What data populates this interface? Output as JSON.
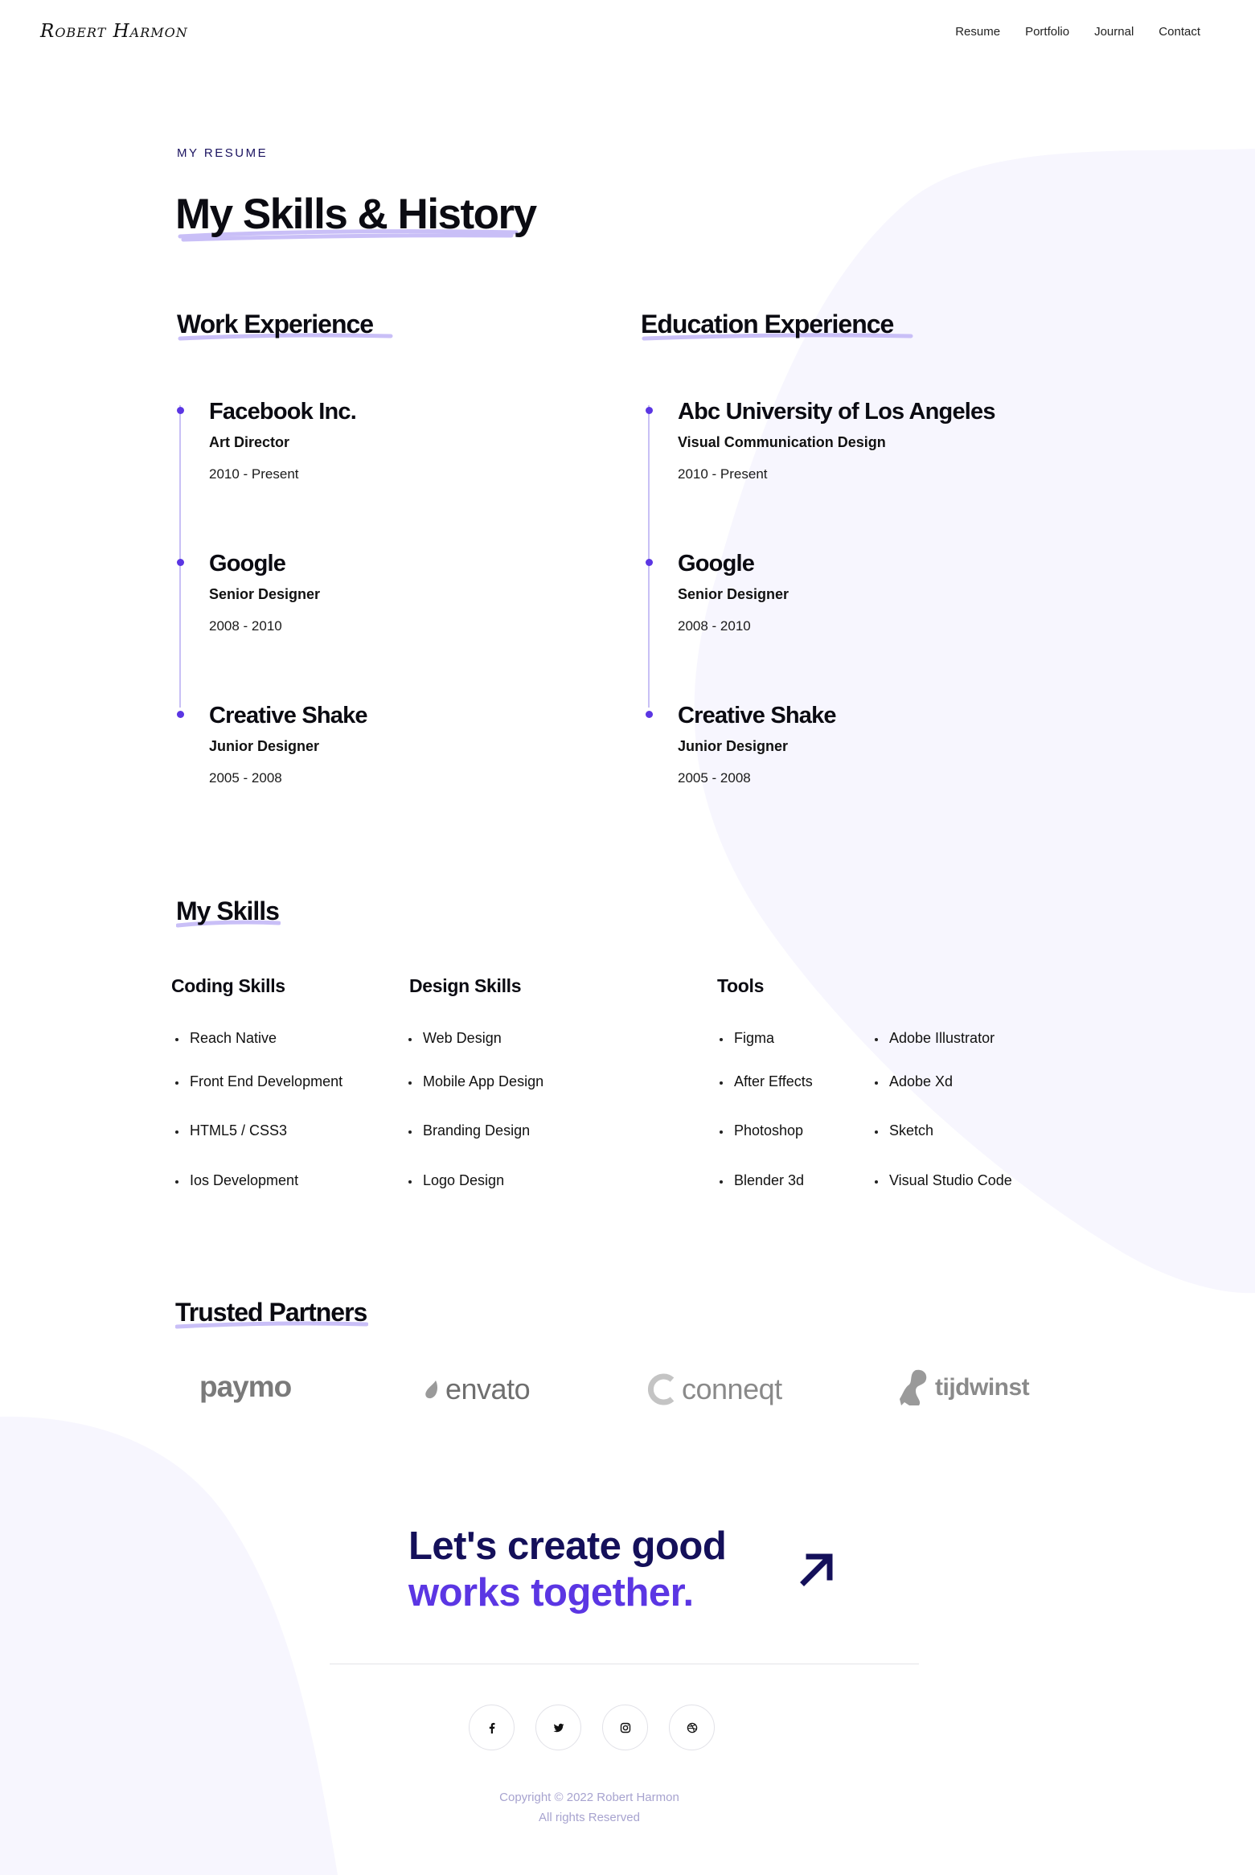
{
  "header": {
    "logo": "Robert Harmon",
    "nav": [
      "Resume",
      "Portfolio",
      "Journal",
      "Contact"
    ]
  },
  "hero": {
    "eyebrow": "MY RESUME",
    "title": "My Skills & History"
  },
  "work": {
    "title": "Work Experience",
    "items": [
      {
        "org": "Facebook Inc.",
        "role": "Art Director",
        "years": "2010 - Present"
      },
      {
        "org": "Google",
        "role": "Senior Designer",
        "years": "2008 - 2010"
      },
      {
        "org": "Creative Shake",
        "role": "Junior Designer",
        "years": "2005 - 2008"
      }
    ]
  },
  "education": {
    "title": "Education Experience",
    "items": [
      {
        "org": "Abc University of Los Angeles",
        "role": "Visual Communication Design",
        "years": "2010 - Present"
      },
      {
        "org": "Google",
        "role": "Senior Designer",
        "years": "2008 - 2010"
      },
      {
        "org": "Creative Shake",
        "role": "Junior Designer",
        "years": "2005 - 2008"
      }
    ]
  },
  "skills": {
    "title": "My Skills",
    "coding": {
      "title": "Coding Skills",
      "items": [
        "Reach Native",
        "Front End Development",
        "HTML5 / CSS3",
        "Ios Development"
      ]
    },
    "design": {
      "title": "Design Skills",
      "items": [
        "Web Design",
        "Mobile App Design",
        "Branding Design",
        "Logo Design"
      ]
    },
    "tools": {
      "title": "Tools",
      "items_a": [
        "Figma",
        "After Effects",
        "Photoshop",
        "Blender 3d"
      ],
      "items_b": [
        "Adobe Illustrator",
        "Adobe Xd",
        "Sketch",
        "Visual Studio Code"
      ]
    }
  },
  "partners": {
    "title": "Trusted Partners",
    "logos": [
      "paymo",
      "envato",
      "conneqt",
      "tijdwinst"
    ]
  },
  "cta": {
    "line1": "Let's create good",
    "line2": "works together."
  },
  "socials": [
    "facebook-icon",
    "twitter-icon",
    "instagram-icon",
    "dribbble-icon"
  ],
  "footer": {
    "copyright": "Copyright © 2022 Robert Harmon",
    "rights": "All rights Reserved"
  },
  "colors": {
    "accent": "#5b36e3",
    "navy": "#14105a",
    "highlight": "#c9bff7",
    "blob": "#f7f6fe"
  }
}
